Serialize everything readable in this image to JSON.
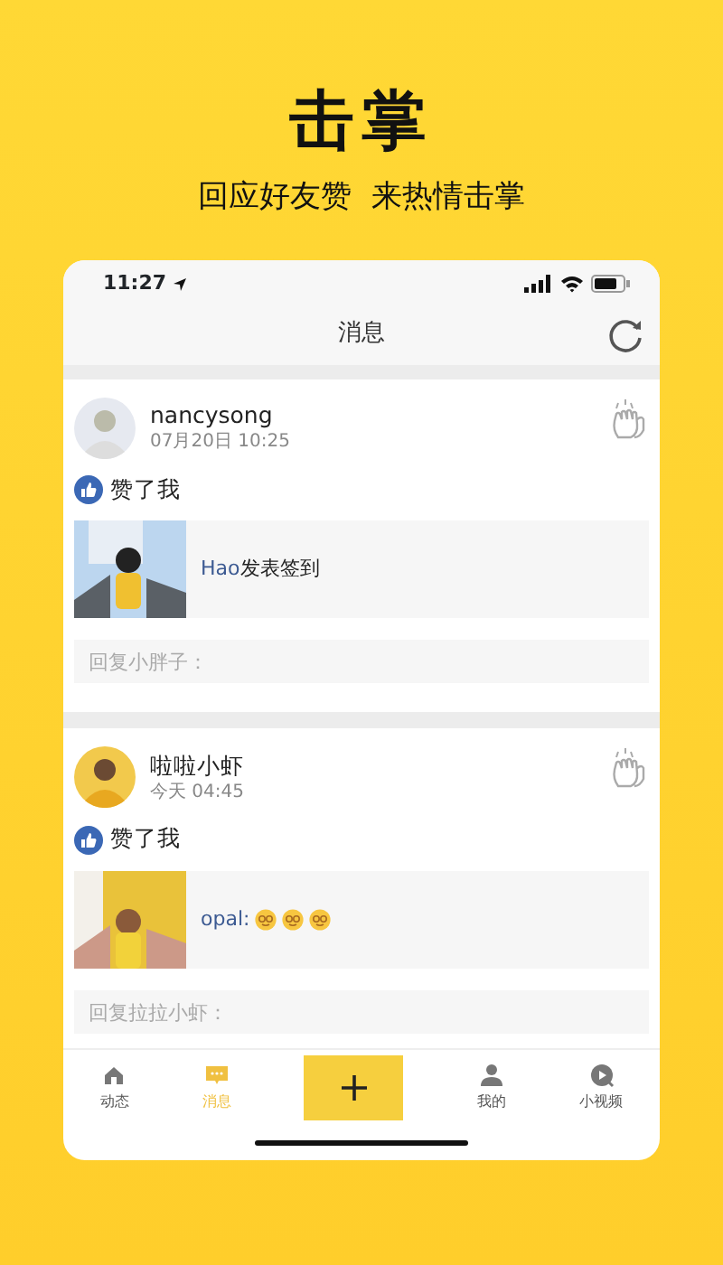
{
  "header": {
    "title": "击掌",
    "subtitle": "回应好友赞  来热情击掌"
  },
  "status_bar": {
    "time": "11:27"
  },
  "nav": {
    "title": "消息"
  },
  "notifications": [
    {
      "user": "nancysong",
      "time": "07月20日 10:25",
      "action": "赞了我",
      "content": [
        {
          "kind": "author",
          "text": "Hao"
        },
        {
          "kind": "text",
          "text": "发表签到"
        }
      ],
      "reply_placeholder": "回复小胖子："
    },
    {
      "user": "啦啦小虾",
      "time": "今天 04:45",
      "action": "赞了我",
      "content": [
        {
          "kind": "author",
          "text": "opal:"
        },
        {
          "kind": "emoji"
        },
        {
          "kind": "emoji"
        },
        {
          "kind": "emoji"
        }
      ],
      "reply_placeholder": "回复拉拉小虾："
    }
  ],
  "tabs": [
    {
      "kind": "tab",
      "label": "动态",
      "selected": false
    },
    {
      "kind": "tab",
      "label": "消息",
      "selected": true
    },
    {
      "kind": "add"
    },
    {
      "kind": "tab",
      "label": "我的",
      "selected": false
    },
    {
      "kind": "tab",
      "label": "小视频",
      "selected": false
    }
  ]
}
